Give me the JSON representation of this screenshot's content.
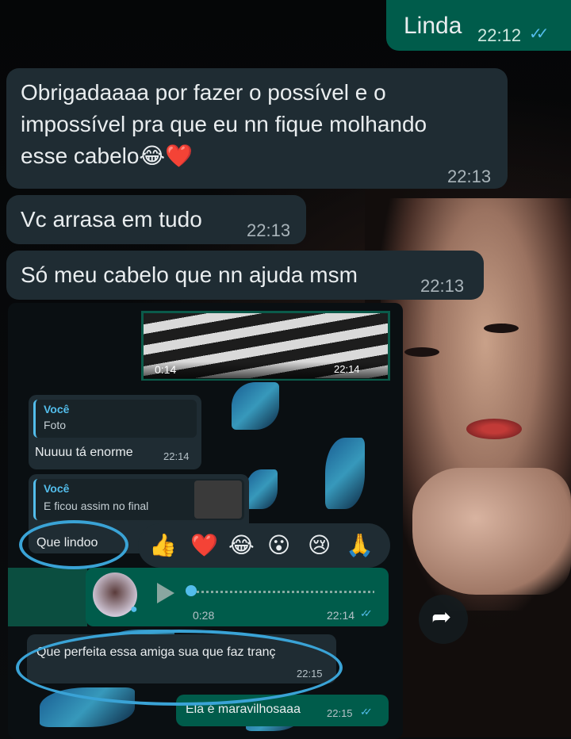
{
  "messages": {
    "out1": {
      "text": "Linda",
      "time": "22:12",
      "ticks": "✓✓"
    },
    "in1": {
      "line1": "Obrigadaaaa por fazer o possível e o",
      "line2": "impossível pra que eu nn fique molhando",
      "line3": "esse cabelo😂❤️",
      "time": "22:13"
    },
    "in2": {
      "text": "Vc arrasa em tudo",
      "time": "22:13"
    },
    "in3": {
      "text": "Só meu cabelo que nn ajuda msm",
      "time": "22:13"
    }
  },
  "embedded": {
    "video": {
      "duration": "0:14",
      "time": "22:14"
    },
    "reply1": {
      "quote_name": "Você",
      "quote_text": "Foto",
      "text": "Nuuuu tá enorme",
      "time": "22:14"
    },
    "reply2": {
      "quote_name": "Você",
      "quote_text": "E ficou assim no final",
      "text": "Que lindoo"
    },
    "reactions": [
      "👍",
      "❤️",
      "😂",
      "😮",
      "😢",
      "🙏"
    ],
    "voice": {
      "duration": "0:28",
      "time": "22:14"
    },
    "msg3": {
      "text": "Que perfeita essa amiga sua que faz tranç",
      "time": "22:15"
    },
    "msg4": {
      "text": "Ela é maravilhosaaa",
      "time": "22:15"
    }
  },
  "icons": {
    "share": "share-arrow-icon",
    "play": "play-icon",
    "mic": "mic-icon"
  },
  "colors": {
    "outgoing": "#005c4b",
    "incoming": "#1f2c33",
    "highlight": "#3aa3d6"
  }
}
